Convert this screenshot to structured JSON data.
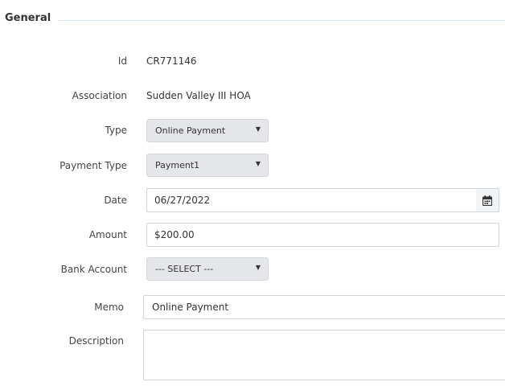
{
  "section": {
    "title": "General"
  },
  "fields": {
    "id": {
      "label": "Id",
      "value": "CR771146"
    },
    "association": {
      "label": "Association",
      "value": "Sudden Valley III HOA"
    },
    "type": {
      "label": "Type",
      "value": "Online Payment"
    },
    "payment_type": {
      "label": "Payment Type",
      "value": "Payment1"
    },
    "date": {
      "label": "Date",
      "value": "06/27/2022"
    },
    "amount": {
      "label": "Amount",
      "value": "$200.00"
    },
    "bank_account": {
      "label": "Bank Account",
      "value": "--- SELECT ---"
    },
    "memo": {
      "label": "Memo",
      "value": "Online Payment"
    },
    "description": {
      "label": "Description",
      "value": ""
    }
  },
  "icons": {
    "dropdown": "caret-down-icon",
    "calendar": "calendar-icon"
  },
  "colors": {
    "select_bg": "#e4e6e9",
    "rule": "#d6e6ee",
    "border": "#cfd4d9"
  }
}
